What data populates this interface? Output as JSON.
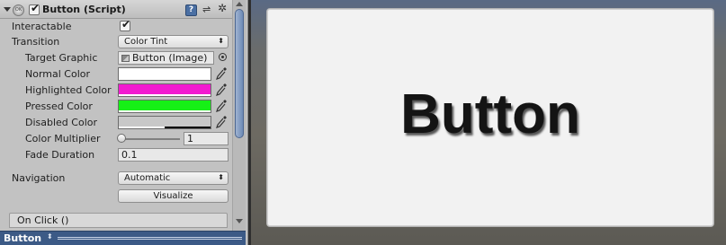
{
  "component": {
    "title": "Button (Script)",
    "icon_text": "OK",
    "enabled": true,
    "help_icon": "help-icon",
    "help_label": "?",
    "preset_icon": "preset-icon",
    "gear_icon": "gear-icon"
  },
  "fields": {
    "interactable": {
      "label": "Interactable",
      "checked": true
    },
    "transition": {
      "label": "Transition",
      "value": "Color Tint"
    },
    "target_graphic": {
      "label": "Target Graphic",
      "value": "Button (Image)"
    },
    "normal_color": {
      "label": "Normal Color",
      "color": "#ffffff"
    },
    "highlighted_color": {
      "label": "Highlighted Color",
      "color": "#f21ad0"
    },
    "pressed_color": {
      "label": "Pressed Color",
      "color": "#16f016"
    },
    "disabled_color": {
      "label": "Disabled Color",
      "color": "#c8c8c8",
      "alpha": 0.5
    },
    "color_multiplier": {
      "label": "Color Multiplier",
      "value": "1",
      "slider_fraction": 0.0
    },
    "fade_duration": {
      "label": "Fade Duration",
      "value": "0.1"
    },
    "navigation": {
      "label": "Navigation",
      "value": "Automatic"
    },
    "visualize": {
      "label": "Visualize"
    }
  },
  "on_click": {
    "label": "On Click ()"
  },
  "statusbar": {
    "label": "Button"
  },
  "game_view": {
    "button_text": "Button",
    "button_bg": "#f2f2f2"
  }
}
